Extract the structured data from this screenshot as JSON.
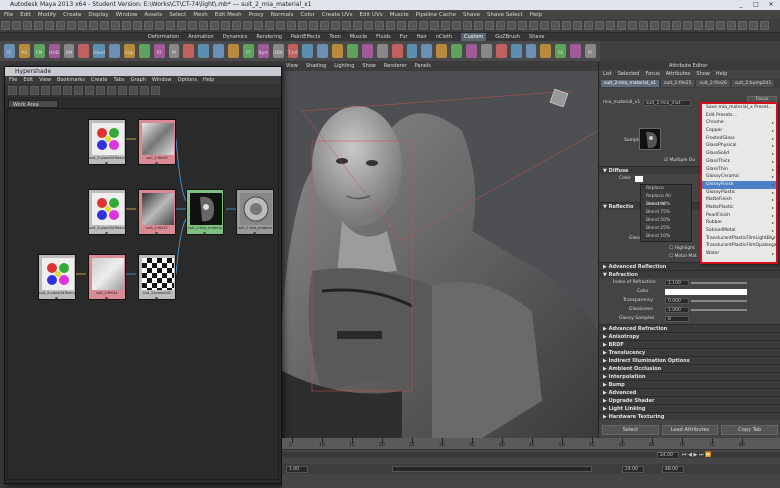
{
  "app": {
    "title": "Autodesk Maya 2013 x64 - Student Version: E:\\Works\\CT\\CT-74\\light\\.mb* --- suit_2_mia_material_x1",
    "controls": [
      "_",
      "□",
      "✕"
    ]
  },
  "main_menu": [
    "File",
    "Edit",
    "Modify",
    "Create",
    "Display",
    "Window",
    "Assets",
    "Select",
    "Mesh",
    "Edit Mesh",
    "Proxy",
    "Normals",
    "Color",
    "Create UVs",
    "Edit UVs",
    "Muscle",
    "Pipeline Cache",
    "Shave",
    "Shave Select",
    "Help"
  ],
  "shelf_tabs": [
    {
      "label": "Deformation",
      "active": false
    },
    {
      "label": "Animation",
      "active": false
    },
    {
      "label": "Dynamics",
      "active": false
    },
    {
      "label": "Rendering",
      "active": false
    },
    {
      "label": "PaintEffects",
      "active": false
    },
    {
      "label": "Toon",
      "active": false
    },
    {
      "label": "Muscle",
      "active": false
    },
    {
      "label": "Fluids",
      "active": false
    },
    {
      "label": "Fur",
      "active": false
    },
    {
      "label": "Hair",
      "active": false
    },
    {
      "label": "nCloth",
      "active": false
    },
    {
      "label": "Custom",
      "active": true
    },
    {
      "label": "GoZBrush",
      "active": false
    },
    {
      "label": "Shave",
      "active": false
    }
  ],
  "shelf_icons": [
    "IC",
    "AS",
    "FM",
    "HUD",
    "AM",
    "",
    "Hood",
    "",
    "Imp",
    "",
    "Rt",
    "M",
    "",
    "",
    "",
    "",
    "FT",
    "Xprt",
    "UDK",
    "T-Jnt",
    "",
    "",
    "",
    "",
    "",
    "",
    "",
    "",
    "",
    "",
    "",
    "",
    "",
    "",
    "",
    "",
    "",
    "SE",
    "",
    "PL",
    "",
    "",
    "CSS"
  ],
  "viewport": {
    "menu": [
      "View",
      "Shading",
      "Lighting",
      "Show",
      "Renderer",
      "Panels"
    ]
  },
  "hypershade": {
    "title": "Hypershade",
    "menu": [
      "File",
      "Edit",
      "View",
      "Bookmarks",
      "Create",
      "Tabs",
      "Graph",
      "Window",
      "Options",
      "Help"
    ],
    "tab": "Work Area",
    "nodes": [
      {
        "id": "n1",
        "label": "suit_2:place2dTextur",
        "kind": "place2d"
      },
      {
        "id": "n2",
        "label": "suit_2:file26",
        "kind": "file"
      },
      {
        "id": "n3",
        "label": "suit_2:place2dTextur",
        "kind": "place2d"
      },
      {
        "id": "n4",
        "label": "suit_2:file25",
        "kind": "file"
      },
      {
        "id": "n5",
        "label": "suit_2:mia_materia",
        "kind": "material"
      },
      {
        "id": "n6",
        "label": "suit_2:mia_materia",
        "kind": "sg"
      },
      {
        "id": "n7",
        "label": "suit_2:place2dTextur",
        "kind": "place2d"
      },
      {
        "id": "n8",
        "label": "suit_2:file24",
        "kind": "file"
      },
      {
        "id": "n9",
        "label": "suit_2:bump2d1",
        "kind": "bump"
      }
    ]
  },
  "attribute_editor": {
    "title": "Attribute Editor",
    "menu": [
      "List",
      "Selected",
      "Focus",
      "Attributes",
      "Show",
      "Help"
    ],
    "tabs": [
      {
        "label": "suit_2:mia_material_x1",
        "active": true
      },
      {
        "label": "suit_2:file25",
        "active": false
      },
      {
        "label": "suit_2:file26",
        "active": false
      },
      {
        "label": "suit_2:bump2d1",
        "active": false
      }
    ],
    "focus_label": "Focus",
    "presets_label": "Presets*",
    "node_field_label": "mia_material_x1",
    "node_field_value": "suit_2:mia_mat",
    "sample_label": "Sample",
    "multiple_label": "Multiple Ou",
    "sections": {
      "diffuse": "Diffuse",
      "reflection": "Reflectio",
      "advanced_reflection": "Advanced Reflection",
      "refraction": "Refraction",
      "advanced_refraction": "Advanced Refraction",
      "anisotropy": "Anisotropy",
      "brdf": "BRDF",
      "translucency": "Translucency",
      "indirect": "Indirect Illumination Options",
      "ambient": "Ambient Occlusion",
      "interpolation": "Interpolation",
      "bump": "Bump",
      "advanced": "Advanced",
      "upgrade": "Upgrade Shader",
      "light_linking": "Light Linking",
      "hardware_texturing": "Hardware Texturing"
    },
    "fields": {
      "color": "Color",
      "glossy_samples_top": "Glossy Sa",
      "highlights": "Highlight",
      "metal": "Metal Mat",
      "index_of_refraction": "Index of Refraction",
      "ior_value": "1.100",
      "refr_color": "Color",
      "transparency": "Transparency",
      "transparency_value": "0.000",
      "glossiness": "Glossiness",
      "glossiness_value": "1.000",
      "glossy_samples": "Glossy Samples",
      "glossy_samples_value": "8"
    },
    "buttons": [
      "Select",
      "Load Attributes",
      "Copy Tab"
    ]
  },
  "preset_context_menu": [
    "Replace",
    "Replace All Selected",
    "Blend 90%",
    "Blend 75%",
    "Blend 50%",
    "Blend 25%",
    "Blend 10%"
  ],
  "presets_dropdown": [
    {
      "label": "Save mia_material_x Preset...",
      "selected": false
    },
    {
      "label": "Edit Presets...",
      "selected": false
    },
    {
      "label": "Chrome",
      "selected": false
    },
    {
      "label": "Copper",
      "selected": false
    },
    {
      "label": "FrostedGlass",
      "selected": false
    },
    {
      "label": "GlassPhysical",
      "selected": false
    },
    {
      "label": "GlassSolid",
      "selected": false
    },
    {
      "label": "GlassThick",
      "selected": false
    },
    {
      "label": "GlassThin",
      "selected": false
    },
    {
      "label": "GlossyCeramic",
      "selected": false
    },
    {
      "label": "GlossyFinish",
      "selected": true
    },
    {
      "label": "GlossyPlastic",
      "selected": false
    },
    {
      "label": "MatteFinish",
      "selected": false
    },
    {
      "label": "MattePlastic",
      "selected": false
    },
    {
      "label": "PearlFinish",
      "selected": false
    },
    {
      "label": "Rubber",
      "selected": false
    },
    {
      "label": "SatinedMetal",
      "selected": false
    },
    {
      "label": "TranslucentPlasticFilmLightBlur",
      "selected": false
    },
    {
      "label": "TranslucentPlasticFilmOpalescent",
      "selected": false
    },
    {
      "label": "Water",
      "selected": false
    }
  ],
  "timeline": {
    "ticks": [
      "5",
      "10",
      "15",
      "20",
      "25",
      "30",
      "35",
      "40",
      "45",
      "50",
      "55",
      "60",
      "65",
      "70",
      "75",
      "80"
    ],
    "current_frame": "24.00",
    "range_start": "1.00",
    "range_end": "24.00",
    "end_value": "48.00"
  },
  "colors": {
    "highlight_red": "#d0101a",
    "selection_blue": "#4d7fc4",
    "node_pink": "#d98a95",
    "node_green": "#7fc07f"
  }
}
